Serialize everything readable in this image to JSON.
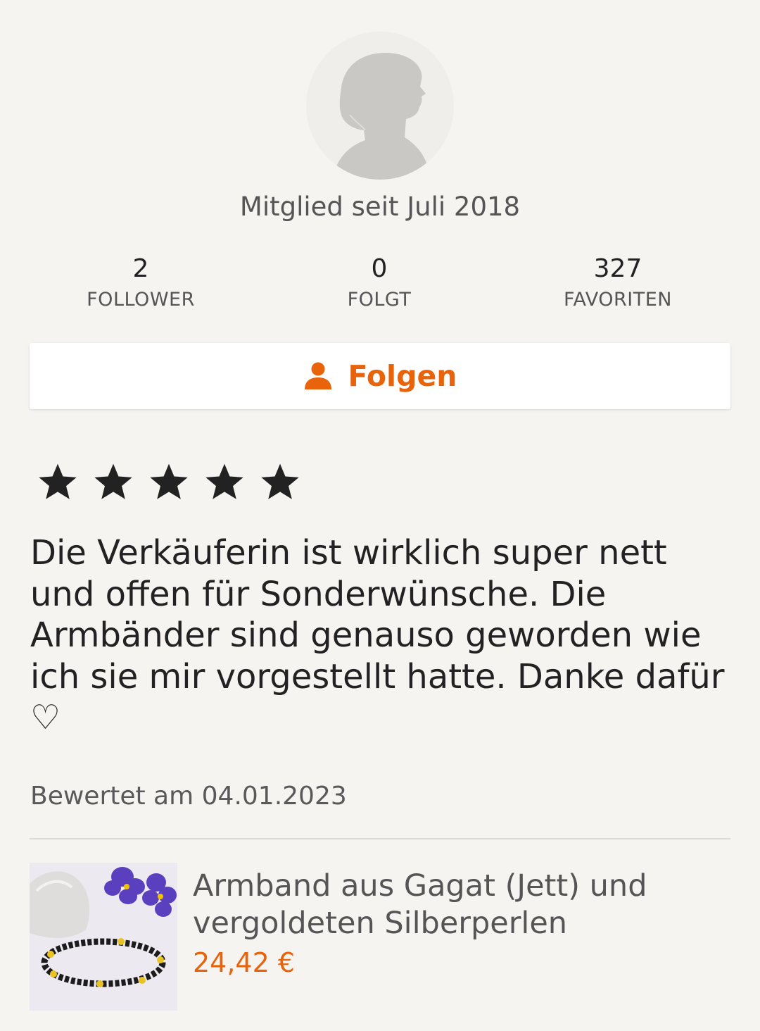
{
  "profile": {
    "avatar_icon": "default-user-silhouette-icon",
    "member_since": "Mitglied seit Juli 2018"
  },
  "stats": [
    {
      "value": "2",
      "label": "FOLLOWER"
    },
    {
      "value": "0",
      "label": "FOLGT"
    },
    {
      "value": "327",
      "label": "FAVORITEN"
    }
  ],
  "follow_button": {
    "icon": "person-icon",
    "label": "Folgen"
  },
  "review": {
    "rating": 5,
    "rating_max": 5,
    "text": "Die Verkäuferin ist wirklich super nett und offen für Sonderwünsche. Die Armbänder sind genauso geworden wie ich sie mir vorgestellt hatte. Danke dafür ♡",
    "date": "Bewertet am 04.01.2023"
  },
  "product": {
    "title": "Armband aus Gagat (Jett) und vergoldeten Silberperlen",
    "price": "24,42 €"
  },
  "colors": {
    "accent": "#e8630a",
    "background": "#f5f4f1"
  }
}
